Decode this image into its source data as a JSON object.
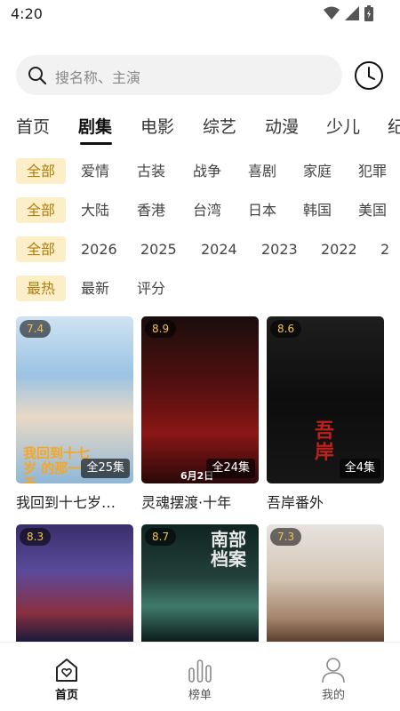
{
  "status": {
    "time": "4:20"
  },
  "search": {
    "placeholder": "搜名称、主演"
  },
  "tabs": [
    "首页",
    "剧集",
    "电影",
    "综艺",
    "动漫",
    "少儿",
    "纪"
  ],
  "filters": {
    "genre": [
      "全部",
      "爱情",
      "古装",
      "战争",
      "喜剧",
      "家庭",
      "犯罪"
    ],
    "region": [
      "全部",
      "大陆",
      "香港",
      "台湾",
      "日本",
      "韩国",
      "美国"
    ],
    "year": [
      "全部",
      "2026",
      "2025",
      "2024",
      "2023",
      "2022",
      "2"
    ],
    "sort": [
      "最热",
      "最新",
      "评分"
    ]
  },
  "cards": [
    {
      "title": "我回到十七岁…",
      "rating": "7.4",
      "episodes": "全25集",
      "poster_overlay": "我回到十七岁 的那一天"
    },
    {
      "title": "灵魂摆渡·十年",
      "rating": "8.9",
      "episodes": "全24集",
      "poster_overlay": "6月2日"
    },
    {
      "title": "吾岸番外",
      "rating": "8.6",
      "episodes": "全4集",
      "poster_overlay": "吾岸"
    },
    {
      "title": "",
      "rating": "8.3",
      "episodes": "",
      "poster_overlay": ""
    },
    {
      "title": "",
      "rating": "8.7",
      "episodes": "",
      "poster_overlay": "南部档案"
    },
    {
      "title": "",
      "rating": "7.3",
      "episodes": "",
      "poster_overlay": ""
    }
  ],
  "nav": {
    "home": "首页",
    "ranking": "榜单",
    "mine": "我的"
  },
  "colors": {
    "accent": "#f6c24a",
    "chip_bg": "#fcefc7",
    "chip_text": "#b07e10"
  }
}
